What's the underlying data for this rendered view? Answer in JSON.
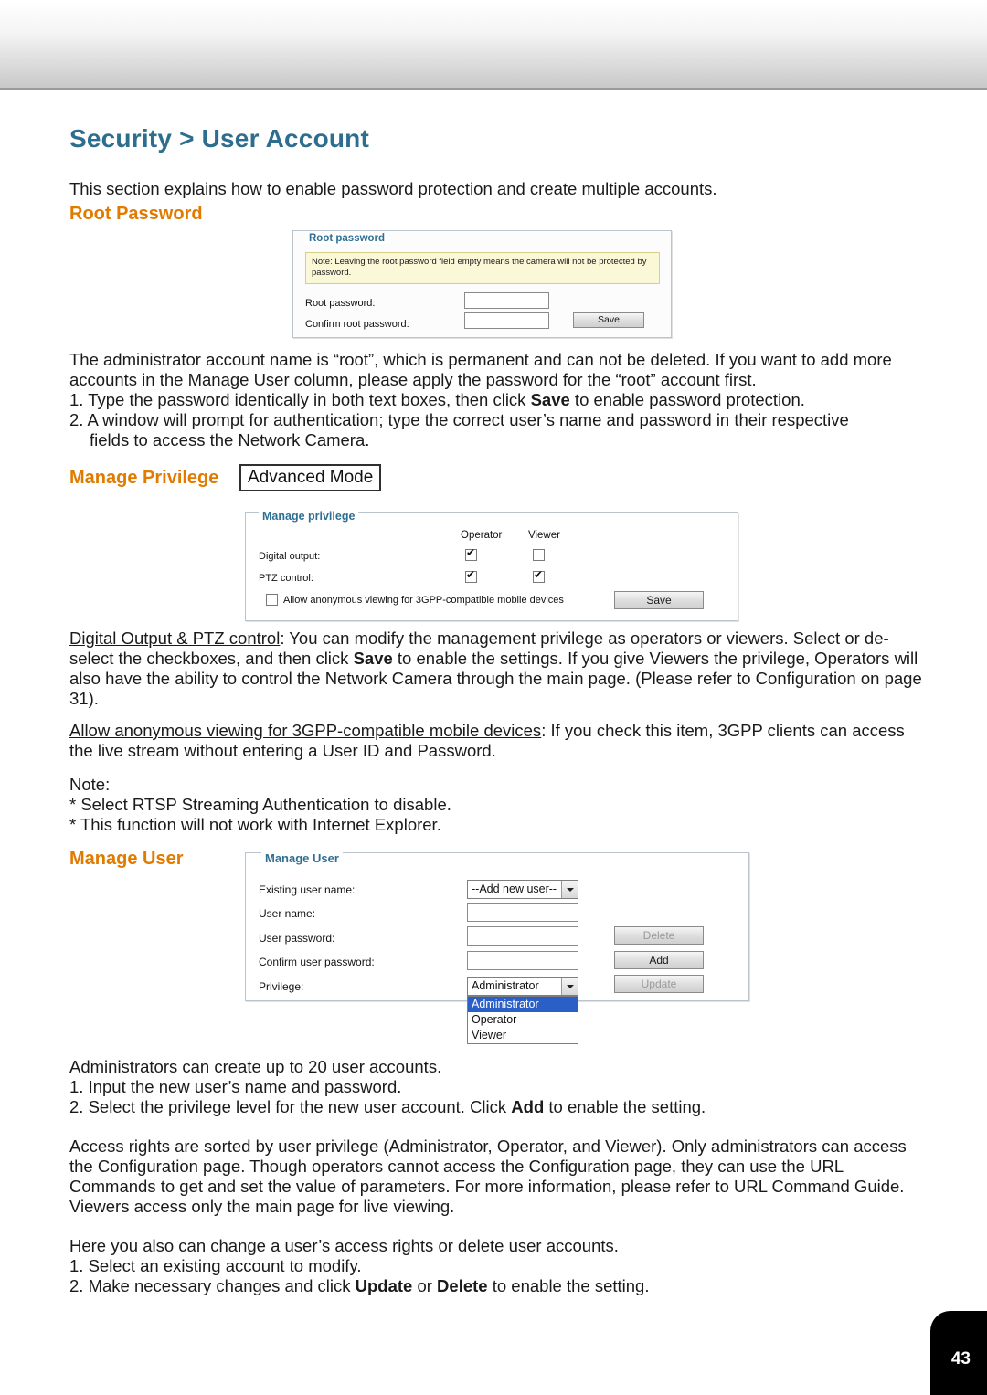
{
  "page": {
    "title": "Security > User Account",
    "number": "43",
    "intro": "This section explains how to enable password protection and create multiple accounts."
  },
  "root_password": {
    "heading": "Root Password",
    "panel_legend": "Root password",
    "note": "Note: Leaving the root password field empty means the camera will not be protected by password.",
    "labels": {
      "root_password": "Root password:",
      "confirm_root_password": "Confirm root password:"
    },
    "values": {
      "root_password": "",
      "confirm_root_password": ""
    },
    "save_button": "Save"
  },
  "paragraphs": {
    "admin_account": "The administrator account name is “root”, which is permanent and can not be deleted. If you want to add more accounts in the Manage User column, please apply the password for the “root” account first.",
    "list_1_item_1_pre": "1. Type the password identically in both text boxes, then click ",
    "list_1_item_1_bold": "Save",
    "list_1_item_1_post": " to enable password protection.",
    "list_1_item_2": "2. A window will prompt for authentication; type the correct user’s name and password in their respective",
    "list_1_item_2_cont": "fields to access the Network Camera.",
    "digital_output_title": "Digital Output & PTZ control",
    "digital_output_body_1": ": You can modify the management privilege as operators or viewers. Select or de-select the checkboxes, and then click ",
    "digital_output_bold": "Save",
    "digital_output_body_2": " to enable the settings. If you give Viewers the privilege, Operators will also have the ability to control the Network Camera through the main page. (Please refer to Configuration on page 31).",
    "anon_title": "Allow anonymous viewing for 3GPP-compatible mobile devices",
    "anon_body": ": If you check this item, 3GPP clients can access the live stream without entering a User ID and Password.",
    "note_label": "Note:",
    "note_line_1": "* Select RTSP Streaming Authentication to disable.",
    "note_line_2": "* This function will not work with Internet Explorer.",
    "admins_line_1": "Administrators can create up to 20 user accounts.",
    "admins_line_2": "1. Input the new user’s name and password.",
    "admins_line_3_pre": "2. Select the privilege level for the new user account. Click ",
    "admins_line_3_bold": "Add",
    "admins_line_3_post": " to enable the setting.",
    "access_rights": "Access rights are sorted by user privilege (Administrator, Operator, and Viewer). Only administrators can access the Configuration page. Though operators cannot access the Configuration page, they can use the URL Commands to get and set the value of parameters. For more information, please refer to URL Command Guide. Viewers access only the main page for live viewing.",
    "here_line_1": "Here you also can change a user’s access rights or delete user accounts.",
    "here_line_2": "1. Select an existing account to modify.",
    "here_line_3_pre": "2. Make necessary changes and click ",
    "here_line_3_bold_1": "Update",
    "here_line_3_mid": " or ",
    "here_line_3_bold_2": "Delete",
    "here_line_3_post": " to enable the setting."
  },
  "manage_privilege": {
    "heading": "Manage Privilege",
    "badge": "Advanced Mode",
    "panel_legend": "Manage privilege",
    "columns": [
      "Operator",
      "Viewer"
    ],
    "rows": [
      {
        "label": "Digital output:",
        "operator_checked": true,
        "viewer_checked": false
      },
      {
        "label": "PTZ control:",
        "operator_checked": true,
        "viewer_checked": true
      }
    ],
    "anon_checkbox_label": "Allow anonymous viewing for 3GPP-compatible mobile devices",
    "anon_checked": false,
    "save_button": "Save"
  },
  "manage_user": {
    "heading": "Manage User",
    "panel_legend": "Manage User",
    "labels": {
      "existing_user_name": "Existing user name:",
      "user_name": "User name:",
      "user_password": "User password:",
      "confirm_user_password": "Confirm user password:",
      "privilege": "Privilege:"
    },
    "existing_user_selected": "--Add new user--",
    "values": {
      "user_name": "",
      "user_password": "",
      "confirm_user_password": ""
    },
    "privilege_selected": "Administrator",
    "privilege_options": [
      "Administrator",
      "Operator",
      "Viewer"
    ],
    "buttons": {
      "delete": "Delete",
      "add": "Add",
      "update": "Update"
    }
  }
}
